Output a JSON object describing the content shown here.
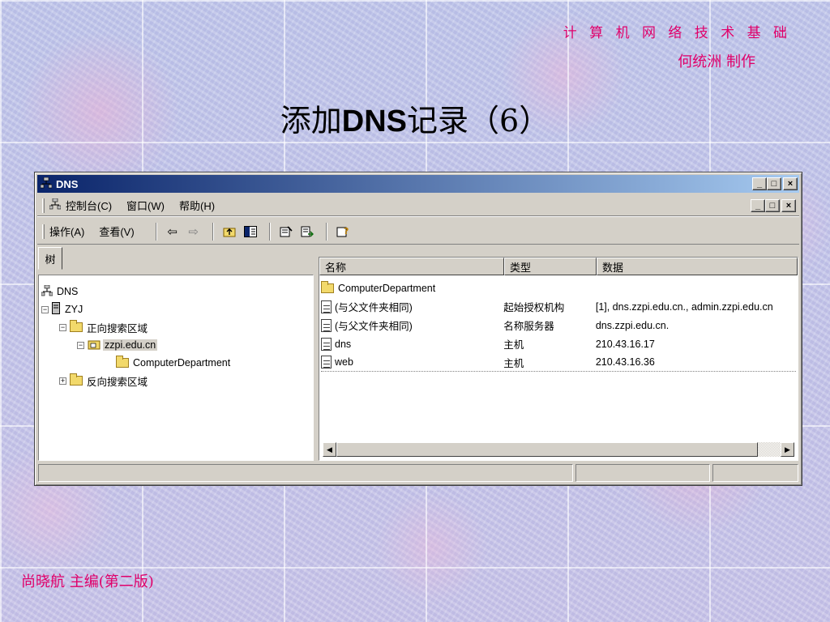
{
  "slide": {
    "course": "计 算 机 网 络 技 术 基 础",
    "author": "何统洲  制作",
    "title_pre": "添加",
    "title_bold": "DNS",
    "title_post": "记录（6）",
    "footer": "尚晓航   主编(第二版)"
  },
  "window": {
    "title": "DNS",
    "caption": {
      "minimize": "_",
      "maximize": "□",
      "close": "×"
    },
    "menubar": {
      "console": "控制台(C)",
      "window": "窗口(W)",
      "help": "帮助(H)"
    },
    "toolbar": {
      "action": "操作(A)",
      "view": "查看(V)"
    },
    "tree_tab": "树",
    "tree": {
      "root": "DNS",
      "server": "ZYJ",
      "forward_zones": "正向搜索区域",
      "zone": "zzpi.edu.cn",
      "subfolder": "ComputerDepartment",
      "reverse_zones": "反向搜索区域"
    },
    "list": {
      "headers": {
        "name": "名称",
        "type": "类型",
        "data": "数据"
      },
      "rows": [
        {
          "name": "ComputerDepartment",
          "type": "",
          "data": "",
          "icon": "folder-icon"
        },
        {
          "name": "(与父文件夹相同)",
          "type": "起始授权机构",
          "data": "[1], dns.zzpi.edu.cn., admin.zzpi.edu.cn",
          "icon": "record-icon"
        },
        {
          "name": "(与父文件夹相同)",
          "type": "名称服务器",
          "data": "dns.zzpi.edu.cn.",
          "icon": "record-icon"
        },
        {
          "name": "dns",
          "type": "主机",
          "data": "210.43.16.17",
          "icon": "record-icon"
        },
        {
          "name": "web",
          "type": "主机",
          "data": "210.43.16.36",
          "icon": "record-icon"
        }
      ]
    }
  }
}
